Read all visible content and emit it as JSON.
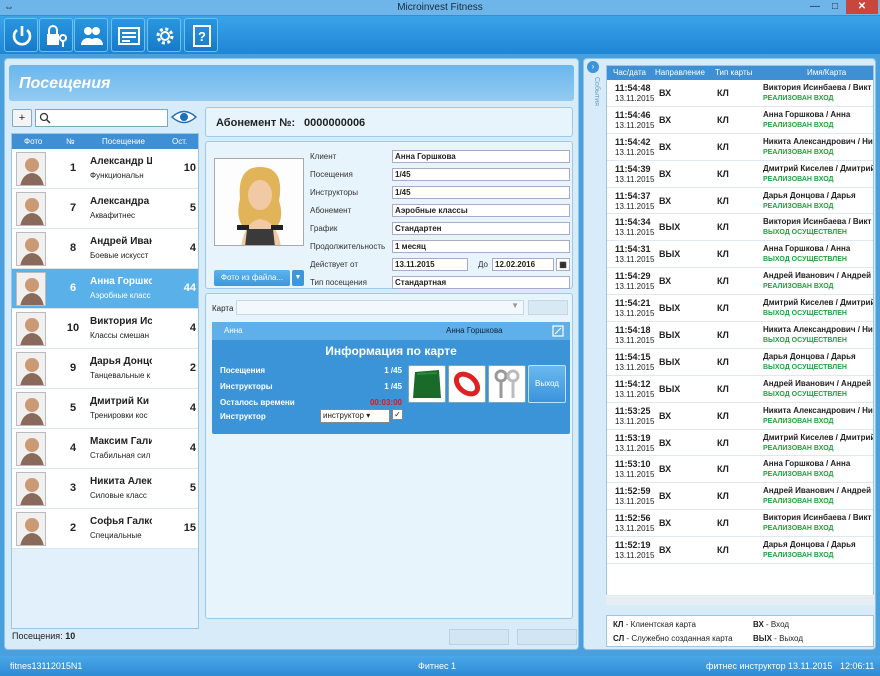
{
  "window": {
    "title": "Microinvest Fitness"
  },
  "page": {
    "title": "Посещения"
  },
  "list": {
    "headers": {
      "photo": "Фото",
      "num": "№",
      "visit": "Посещение",
      "remain": "Ост."
    },
    "rows": [
      {
        "num": "1",
        "name": "Александр Ш",
        "desc": "Функциональн",
        "remain": "10"
      },
      {
        "num": "7",
        "name": "Александра",
        "desc": "Аквафитнес",
        "remain": "5"
      },
      {
        "num": "8",
        "name": "Андрей Иван",
        "desc": "Боевые искусст",
        "remain": "4"
      },
      {
        "num": "6",
        "name": "Анна Горшко",
        "desc": "Аэробные класс",
        "remain": "44"
      },
      {
        "num": "10",
        "name": "Виктория Ис",
        "desc": "Классы смешан",
        "remain": "4"
      },
      {
        "num": "9",
        "name": "Дарья Донцо",
        "desc": "Танцевальные к",
        "remain": "2"
      },
      {
        "num": "5",
        "name": "Дмитрий Ки",
        "desc": "Тренировки кос",
        "remain": "4"
      },
      {
        "num": "4",
        "name": "Максим Гали",
        "desc": "Стабильная сил",
        "remain": "4"
      },
      {
        "num": "3",
        "name": "Никита Алек",
        "desc": "Силовые класс",
        "remain": "5"
      },
      {
        "num": "2",
        "name": "Софья Галко",
        "desc": "Специальные",
        "remain": "15"
      }
    ],
    "visits_label": "Посещения:",
    "visits_count": "10"
  },
  "subscription": {
    "label": "Абонемент №:",
    "number": "0000000006"
  },
  "details": {
    "photo_button": "Фото из файла...",
    "fields": [
      {
        "label": "Клиент",
        "value": "Анна Горшкова"
      },
      {
        "label": "Посещения",
        "value": "1/45"
      },
      {
        "label": "Инструкторы",
        "value": "1/45"
      },
      {
        "label": "Абонемент",
        "value": "Аэробные классы"
      },
      {
        "label": "График",
        "value": "Стандартен"
      },
      {
        "label": "Продолжительность",
        "value": "1 месяц"
      }
    ],
    "valid_from_label": "Действует от",
    "valid_from": "13.11.2015",
    "valid_to_label": "До",
    "valid_to": "12.02.2016",
    "visit_type_label": "Тип посещения",
    "visit_type": "Стандартная"
  },
  "card": {
    "label": "Карта",
    "owner_first": "Анна",
    "owner_full": "Анна Горшкова",
    "info_title": "Информация по карте",
    "visits_label": "Посещения",
    "visits_value": "1 /45",
    "instructors_label": "Инструкторы",
    "instructors_value": "1 /45",
    "time_left_label": "Осталось времени",
    "time_left_value": "00:03:00",
    "instructor_label": "Инструктор",
    "instructor_value": "инструктор",
    "exit_button": "Выход"
  },
  "events": {
    "side_label": "События",
    "headers": {
      "time": "Час/дата",
      "dir": "Направление",
      "type": "Тип карты",
      "name": "Имя/Карта"
    },
    "rows": [
      {
        "time": "11:54:48",
        "date": "13.11.2015",
        "dir": "ВХ",
        "type": "КЛ",
        "name": "Виктория Исинбаева / Викт",
        "status": "РЕАЛИЗОВАН ВХОД"
      },
      {
        "time": "11:54:46",
        "date": "13.11.2015",
        "dir": "ВХ",
        "type": "КЛ",
        "name": "Анна Горшкова / Анна",
        "status": "РЕАЛИЗОВАН ВХОД"
      },
      {
        "time": "11:54:42",
        "date": "13.11.2015",
        "dir": "ВХ",
        "type": "КЛ",
        "name": "Никита Александрович / Ни",
        "status": "РЕАЛИЗОВАН ВХОД"
      },
      {
        "time": "11:54:39",
        "date": "13.11.2015",
        "dir": "ВХ",
        "type": "КЛ",
        "name": "Дмитрий Киселев / Дмитрий",
        "status": "РЕАЛИЗОВАН ВХОД"
      },
      {
        "time": "11:54:37",
        "date": "13.11.2015",
        "dir": "ВХ",
        "type": "КЛ",
        "name": "Дарья Донцова / Дарья",
        "status": "РЕАЛИЗОВАН ВХОД"
      },
      {
        "time": "11:54:34",
        "date": "13.11.2015",
        "dir": "ВЫХ",
        "type": "КЛ",
        "name": "Виктория Исинбаева / Викт",
        "status": "ВЫХОД ОСУЩЕСТВЛЕН"
      },
      {
        "time": "11:54:31",
        "date": "13.11.2015",
        "dir": "ВЫХ",
        "type": "КЛ",
        "name": "Анна Горшкова / Анна",
        "status": "ВЫХОД ОСУЩЕСТВЛЕН"
      },
      {
        "time": "11:54:29",
        "date": "13.11.2015",
        "dir": "ВХ",
        "type": "КЛ",
        "name": "Андрей Иванович / Андрей",
        "status": "РЕАЛИЗОВАН ВХОД"
      },
      {
        "time": "11:54:21",
        "date": "13.11.2015",
        "dir": "ВЫХ",
        "type": "КЛ",
        "name": "Дмитрий Киселев / Дмитрий",
        "status": "ВЫХОД ОСУЩЕСТВЛЕН"
      },
      {
        "time": "11:54:18",
        "date": "13.11.2015",
        "dir": "ВЫХ",
        "type": "КЛ",
        "name": "Никита Александрович / Ни",
        "status": "ВЫХОД ОСУЩЕСТВЛЕН"
      },
      {
        "time": "11:54:15",
        "date": "13.11.2015",
        "dir": "ВЫХ",
        "type": "КЛ",
        "name": "Дарья Донцова / Дарья",
        "status": "ВЫХОД ОСУЩЕСТВЛЕН"
      },
      {
        "time": "11:54:12",
        "date": "13.11.2015",
        "dir": "ВЫХ",
        "type": "КЛ",
        "name": "Андрей Иванович / Андрей",
        "status": "ВЫХОД ОСУЩЕСТВЛЕН"
      },
      {
        "time": "11:53:25",
        "date": "13.11.2015",
        "dir": "ВХ",
        "type": "КЛ",
        "name": "Никита Александрович / Ни",
        "status": "РЕАЛИЗОВАН ВХОД"
      },
      {
        "time": "11:53:19",
        "date": "13.11.2015",
        "dir": "ВХ",
        "type": "КЛ",
        "name": "Дмитрий Киселев / Дмитрий",
        "status": "РЕАЛИЗОВАН ВХОД"
      },
      {
        "time": "11:53:10",
        "date": "13.11.2015",
        "dir": "ВХ",
        "type": "КЛ",
        "name": "Анна Горшкова / Анна",
        "status": "РЕАЛИЗОВАН ВХОД"
      },
      {
        "time": "11:52:59",
        "date": "13.11.2015",
        "dir": "ВХ",
        "type": "КЛ",
        "name": "Андрей Иванович / Андрей",
        "status": "РЕАЛИЗОВАН ВХОД"
      },
      {
        "time": "11:52:56",
        "date": "13.11.2015",
        "dir": "ВХ",
        "type": "КЛ",
        "name": "Виктория Исинбаева / Викт",
        "status": "РЕАЛИЗОВАН ВХОД"
      },
      {
        "time": "11:52:19",
        "date": "13.11.2015",
        "dir": "ВХ",
        "type": "КЛ",
        "name": "Дарья Донцова / Дарья",
        "status": "РЕАЛИЗОВАН ВХОД"
      }
    ],
    "legend": {
      "kl": "КЛ",
      "kl_text": " - Клиентская карта",
      "sl": "СЛ",
      "sl_text": " - Служебно созданная карта",
      "vh": "ВХ",
      "vh_text": " - Вход",
      "vyh": "ВЫХ",
      "vyh_text": " - Выход"
    }
  },
  "statusbar": {
    "left": "fitnes13112015N1",
    "center": "Фитнес 1",
    "user": "фитнес инструктор",
    "date": "13.11.2015",
    "time": "12:06:11"
  },
  "colors": {
    "accent": "#3f8fd4",
    "selected_row": "#5ab1ea",
    "status_green": "#1fa341",
    "time_red": "#e01818"
  },
  "icons": [
    "power-icon",
    "lock-key-icon",
    "users-icon",
    "card-icon",
    "gear-icon",
    "help-icon",
    "search-icon",
    "eye-icon",
    "edit-icon"
  ]
}
